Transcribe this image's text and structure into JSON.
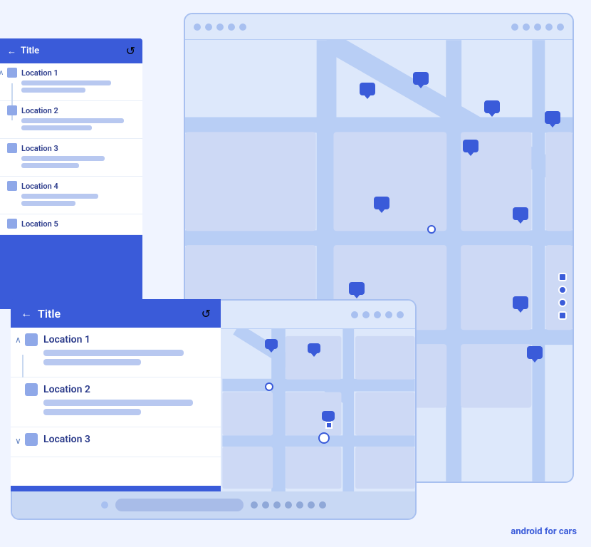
{
  "brand": {
    "text_plain": "android ",
    "text_bold": "for cars"
  },
  "back_window": {
    "dots": [
      "dot1",
      "dot2",
      "dot3",
      "dot4",
      "dot5",
      "dot6",
      "dot7",
      "dot8",
      "dot9",
      "dot10"
    ]
  },
  "sidebar_back": {
    "back_label": "←",
    "title": "Title",
    "refresh_label": "↺",
    "items": [
      {
        "name": "Location 1",
        "bar1_width": "70%",
        "bar2_width": "50%",
        "chevron": "^"
      },
      {
        "name": "Location 2",
        "bar1_width": "80%",
        "bar2_width": "55%"
      },
      {
        "name": "Location 3",
        "bar1_width": "65%",
        "bar2_width": "45%"
      },
      {
        "name": "Location 4",
        "bar1_width": "60%",
        "bar2_width": "42%"
      },
      {
        "name": "Location 5",
        "bar1_width": "0%",
        "bar2_width": "0%"
      }
    ]
  },
  "sidebar_front": {
    "back_label": "←",
    "title": "Title",
    "refresh_label": "↺",
    "items": [
      {
        "name": "Location 1",
        "bar1_width": "75%",
        "bar2_width": "55%",
        "chevron": "^",
        "has_divider": true
      },
      {
        "name": "Location 2",
        "bar1_width": "80%",
        "bar2_width": "52%"
      },
      {
        "name": "Location 3",
        "bar1_width": "0%",
        "bar2_width": "0%",
        "chevron": "v"
      }
    ]
  },
  "front_window": {
    "bottom_dots": [
      "d1",
      "d2",
      "d3",
      "d4",
      "d5",
      "d6",
      "d7",
      "d8"
    ]
  }
}
